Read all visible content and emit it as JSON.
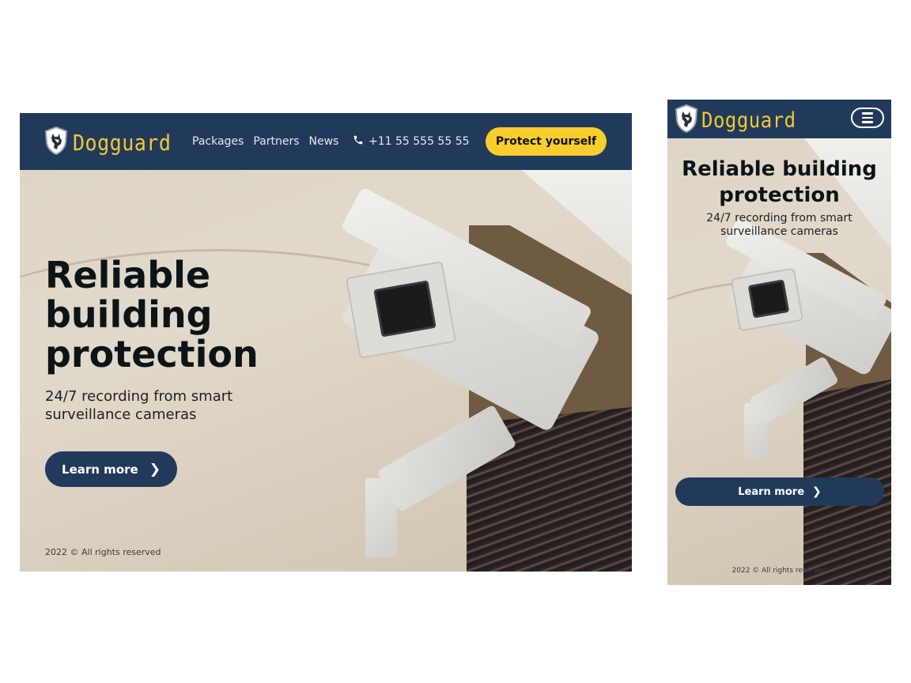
{
  "brand": {
    "name": "Dogguard",
    "logo_icon": "dog-shield-icon",
    "colors": {
      "navy": "#213a5c",
      "yellow": "#f8cd2e",
      "logo_text": "#f4c832"
    }
  },
  "desktop": {
    "nav": {
      "links": [
        {
          "label": "Packages"
        },
        {
          "label": "Partners"
        },
        {
          "label": "News"
        }
      ],
      "phone_icon": "phone-icon",
      "phone": "+11 55 555 55 55",
      "cta_label": "Protect yourself"
    },
    "hero": {
      "title_lines": [
        "Reliable",
        "building",
        "protection"
      ],
      "subtitle": "24/7 recording from smart surveillance cameras",
      "button_label": "Learn more",
      "button_icon": "chevron-right-icon"
    },
    "footer": "2022 © All rights reserved"
  },
  "mobile": {
    "nav": {
      "menu_icon": "hamburger-menu-icon"
    },
    "hero": {
      "title": "Reliable building protection",
      "subtitle": "24/7 recording from smart surveillance cameras",
      "button_label": "Learn more",
      "button_icon": "chevron-right-icon"
    },
    "footer": "2022 © All rights reserved"
  }
}
